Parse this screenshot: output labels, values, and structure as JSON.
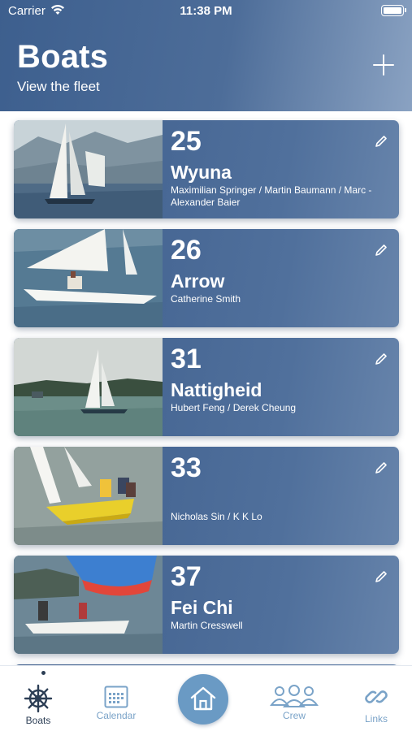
{
  "status_bar": {
    "carrier": "Carrier",
    "time": "11:38 PM"
  },
  "header": {
    "title": "Boats",
    "subtitle": "View the fleet"
  },
  "boats": [
    {
      "number": "25",
      "name": "Wyuna",
      "crew": "Maximilian Springer / Martin Baumann / Marc - Alexander Baier"
    },
    {
      "number": "26",
      "name": "Arrow",
      "crew": "Catherine Smith"
    },
    {
      "number": "31",
      "name": "Nattigheid",
      "crew": "Hubert Feng / Derek Cheung"
    },
    {
      "number": "33",
      "name": "",
      "crew": "Nicholas Sin / K K Lo"
    },
    {
      "number": "37",
      "name": "Fei Chi",
      "crew": "Martin Cresswell"
    }
  ],
  "tabs": {
    "boats": "Boats",
    "calendar": "Calendar",
    "crew": "Crew",
    "links": "Links"
  },
  "colors": {
    "header": "#4d6d99",
    "card": "#4a6a97",
    "tab_active": "#2c3e55",
    "tab_inactive": "#7aa3c8",
    "home": "#6a9ac4"
  },
  "icons": [
    "wifi-icon",
    "battery-icon",
    "plus-icon",
    "pencil-icon",
    "helm-icon",
    "calendar-icon",
    "home-icon",
    "crew-icon",
    "link-icon"
  ]
}
